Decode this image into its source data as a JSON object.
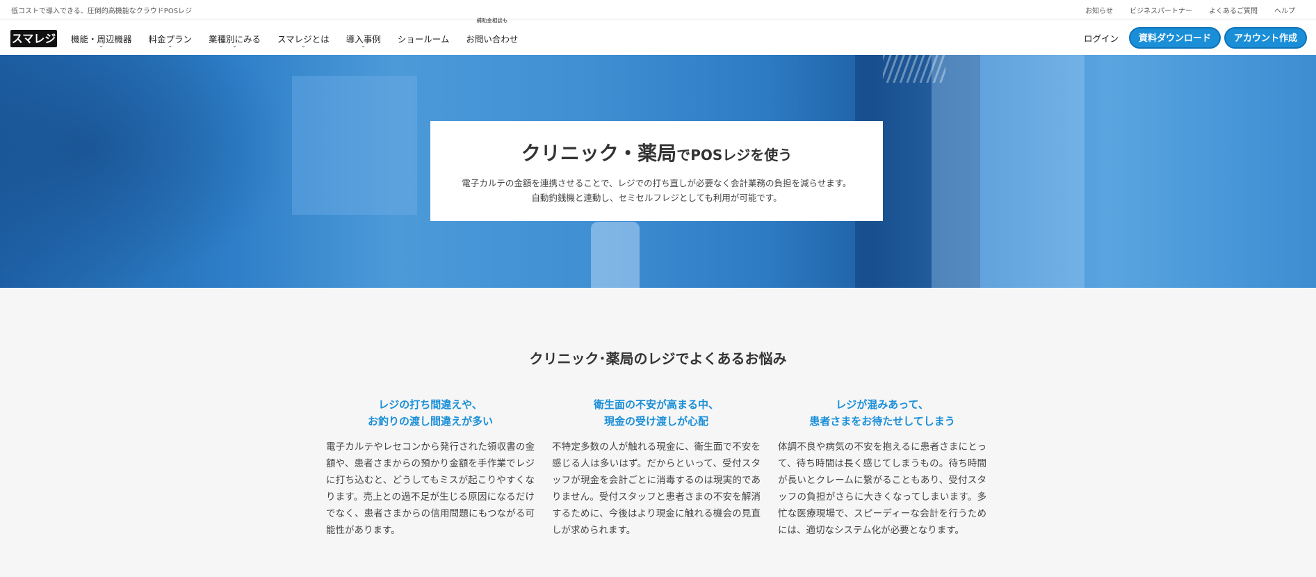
{
  "topbar": {
    "tagline": "低コストで導入できる、圧倒的高機能なクラウドPOSレジ",
    "links": [
      "お知らせ",
      "ビジネスパートナー",
      "よくあるご質問",
      "ヘルプ"
    ]
  },
  "nav": {
    "logo": "スマレジ",
    "items": [
      "機能・周辺機器",
      "料金プラン",
      "業種別にみる",
      "スマレジとは",
      "導入事例",
      "ショールーム",
      "お問い合わせ"
    ],
    "badge": "補助金相談も",
    "login": "ログイン",
    "download_button": "資料ダウンロード",
    "account_button": "アカウント作成"
  },
  "hero": {
    "title_big": "クリニック・薬局",
    "title_small_1": "で",
    "title_mid": "POSレジ",
    "title_small_2": "を使う",
    "desc_line1": "電子カルテの金額を連携させることで、レジでの打ち直しが必要なく会計業務の負担を減らせます。",
    "desc_line2": "自動釣銭機と連動し、セミセルフレジとしても利用が可能です。"
  },
  "problems": {
    "title": "クリニック･薬局のレジでよくあるお悩み",
    "items": [
      {
        "title_line1": "レジの打ち間違えや、",
        "title_line2": "お釣りの渡し間違えが多い",
        "body": "電子カルテやレセコンから発行された領収書の金額や、患者さまからの預かり金額を手作業でレジに打ち込むと、どうしてもミスが起こりやすくなります。売上との過不足が生じる原因になるだけでなく、患者さまからの信用問題にもつながる可能性があります。"
      },
      {
        "title_line1": "衛生面の不安が高まる中、",
        "title_line2": "現金の受け渡しが心配",
        "body": "不特定多数の人が触れる現金に、衛生面で不安を感じる人は多いはず。だからといって、受付スタッフが現金を会計ごとに消毒するのは現実的でありません。受付スタッフと患者さまの不安を解消するために、今後はより現金に触れる機会の見直しが求められます。"
      },
      {
        "title_line1": "レジが混みあって、",
        "title_line2": "患者さまをお待たせしてしまう",
        "body": "体調不良や病気の不安を抱えるに患者さまにとって、待ち時間は長く感じてしまうもの。待ち時間が長いとクレームに繋がることもあり、受付スタッフの負担がさらに大きくなってしまいます。多忙な医療現場で、スピーディーな会計を行うためには、適切なシステム化が必要となります。"
      }
    ]
  },
  "colors": {
    "accent": "#1a8fd8",
    "hero_blue": "#2e7bc4",
    "section_bg": "#f6f6f6"
  }
}
